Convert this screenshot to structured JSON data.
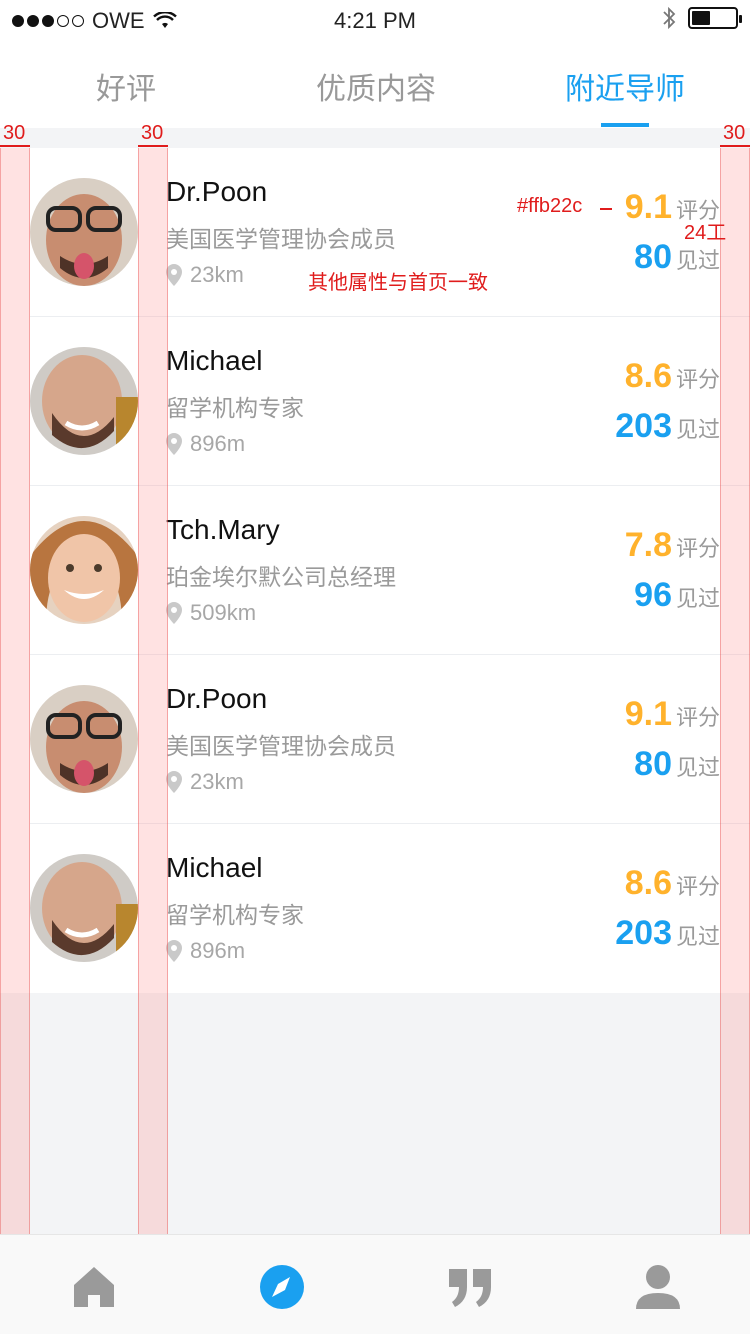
{
  "status_bar": {
    "carrier": "OWE",
    "time": "4:21 PM"
  },
  "tabs": [
    {
      "label": "好评",
      "active": false
    },
    {
      "label": "优质内容",
      "active": false
    },
    {
      "label": "附近导师",
      "active": true
    }
  ],
  "mentors": [
    {
      "name": "Dr.Poon",
      "title": "美国医学管理协会成员",
      "distance": "23km",
      "score": "9.1",
      "score_label": "评分",
      "seen": "80",
      "seen_label": "见过"
    },
    {
      "name": "Michael",
      "title": "留学机构专家",
      "distance": "896m",
      "score": "8.6",
      "score_label": "评分",
      "seen": "203",
      "seen_label": "见过"
    },
    {
      "name": "Tch.Mary",
      "title": "珀金埃尔默公司总经理",
      "distance": "509km",
      "score": "7.8",
      "score_label": "评分",
      "seen": "96",
      "seen_label": "见过"
    },
    {
      "name": "Dr.Poon",
      "title": "美国医学管理协会成员",
      "distance": "23km",
      "score": "9.1",
      "score_label": "评分",
      "seen": "80",
      "seen_label": "见过"
    },
    {
      "name": "Michael",
      "title": "留学机构专家",
      "distance": "896m",
      "score": "8.6",
      "score_label": "评分",
      "seen": "203",
      "seen_label": "见过"
    }
  ],
  "annotations": {
    "margin_left": "30",
    "margin_text": "30",
    "margin_right": "30",
    "color_note": "#ffb22c",
    "size_note": "24工",
    "props_note": "其他属性与首页一致"
  },
  "bottom_nav": [
    "home-icon",
    "compass-icon",
    "quote-icon",
    "user-icon"
  ],
  "colors": {
    "accent": "#1aa0f0",
    "score": "#ffb22c",
    "annotation": "#e01c1c"
  }
}
